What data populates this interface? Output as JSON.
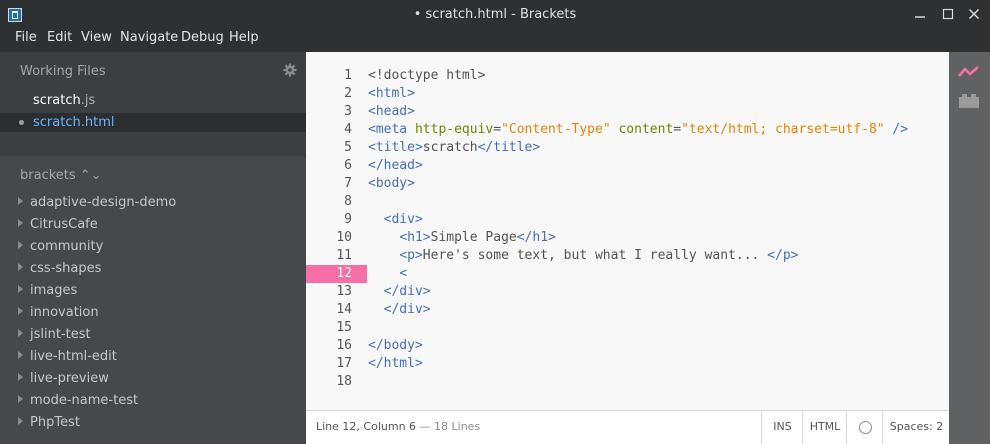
{
  "window": {
    "title": "• scratch.html - Brackets",
    "buttons": [
      "minimize",
      "maximize",
      "close"
    ]
  },
  "menu": [
    "File",
    "Edit",
    "View",
    "Navigate",
    "Debug",
    "Help"
  ],
  "sidebar": {
    "working_files_label": "Working Files",
    "files": [
      {
        "name": "scratch",
        "ext": ".js",
        "selected": false
      },
      {
        "name": "scratch",
        "ext": ".html",
        "selected": true
      }
    ],
    "project_label": "brackets ⌃⌄",
    "tree": [
      "adaptive-design-demo",
      "CitrusCafe",
      "community",
      "css-shapes",
      "images",
      "innovation",
      "jslint-test",
      "live-html-edit",
      "live-preview",
      "mode-name-test",
      "PhpTest"
    ]
  },
  "editor": {
    "active_line": 12,
    "line_numbers": [
      "1",
      "2",
      "3",
      "4",
      "5",
      "6",
      "7",
      "8",
      "9",
      "10",
      "11",
      "12",
      "13",
      "14",
      "15",
      "16",
      "17",
      "18"
    ],
    "lines": [
      [
        [
          "tx",
          "<!doctype html>"
        ]
      ],
      [
        [
          "tg",
          "<html>"
        ]
      ],
      [
        [
          "tg",
          "<head>"
        ]
      ],
      [
        [
          "tg",
          "<meta "
        ],
        [
          "at",
          "http-equiv"
        ],
        [
          "tx",
          "="
        ],
        [
          "st",
          "\"Content-Type\""
        ],
        [
          "tx",
          " "
        ],
        [
          "at",
          "content"
        ],
        [
          "tx",
          "="
        ],
        [
          "st",
          "\"text/html; charset=utf-8\""
        ],
        [
          "tg",
          " />"
        ]
      ],
      [
        [
          "tg",
          "<title>"
        ],
        [
          "tx",
          "scratch"
        ],
        [
          "tg",
          "</title>"
        ]
      ],
      [
        [
          "tg",
          "</head>"
        ]
      ],
      [
        [
          "tg",
          "<body>"
        ]
      ],
      [],
      [
        [
          "tx",
          "  "
        ],
        [
          "tg",
          "<div>"
        ]
      ],
      [
        [
          "tx",
          "    "
        ],
        [
          "tg",
          "<h1>"
        ],
        [
          "tx",
          "Simple Page"
        ],
        [
          "tg",
          "</h1>"
        ]
      ],
      [
        [
          "tx",
          "    "
        ],
        [
          "tg",
          "<p>"
        ],
        [
          "tx",
          "Here's some text, but what I really want... "
        ],
        [
          "tg",
          "</p>"
        ]
      ],
      [
        [
          "tx",
          "    "
        ],
        [
          "tg",
          "<"
        ]
      ],
      [
        [
          "tx",
          "  "
        ],
        [
          "tg",
          "</div>"
        ]
      ],
      [
        [
          "tx",
          "  "
        ],
        [
          "tg",
          "</div>"
        ]
      ],
      [],
      [
        [
          "tg",
          "</body>"
        ]
      ],
      [
        [
          "tg",
          "</html>"
        ]
      ],
      []
    ]
  },
  "statusbar": {
    "position": "Line 12, Column 6",
    "line_count": " — 18 Lines",
    "insert_mode": "INS",
    "language": "HTML",
    "spaces_label": "Spaces:  2"
  },
  "colors": {
    "tag": "#446fbd",
    "attribute": "#6d8600",
    "string": "#e88501",
    "active_line": "#f76fa4",
    "selection_text": "#6bb5ff"
  },
  "right_toolbar": [
    "live-preview-icon",
    "extension-manager-icon"
  ]
}
